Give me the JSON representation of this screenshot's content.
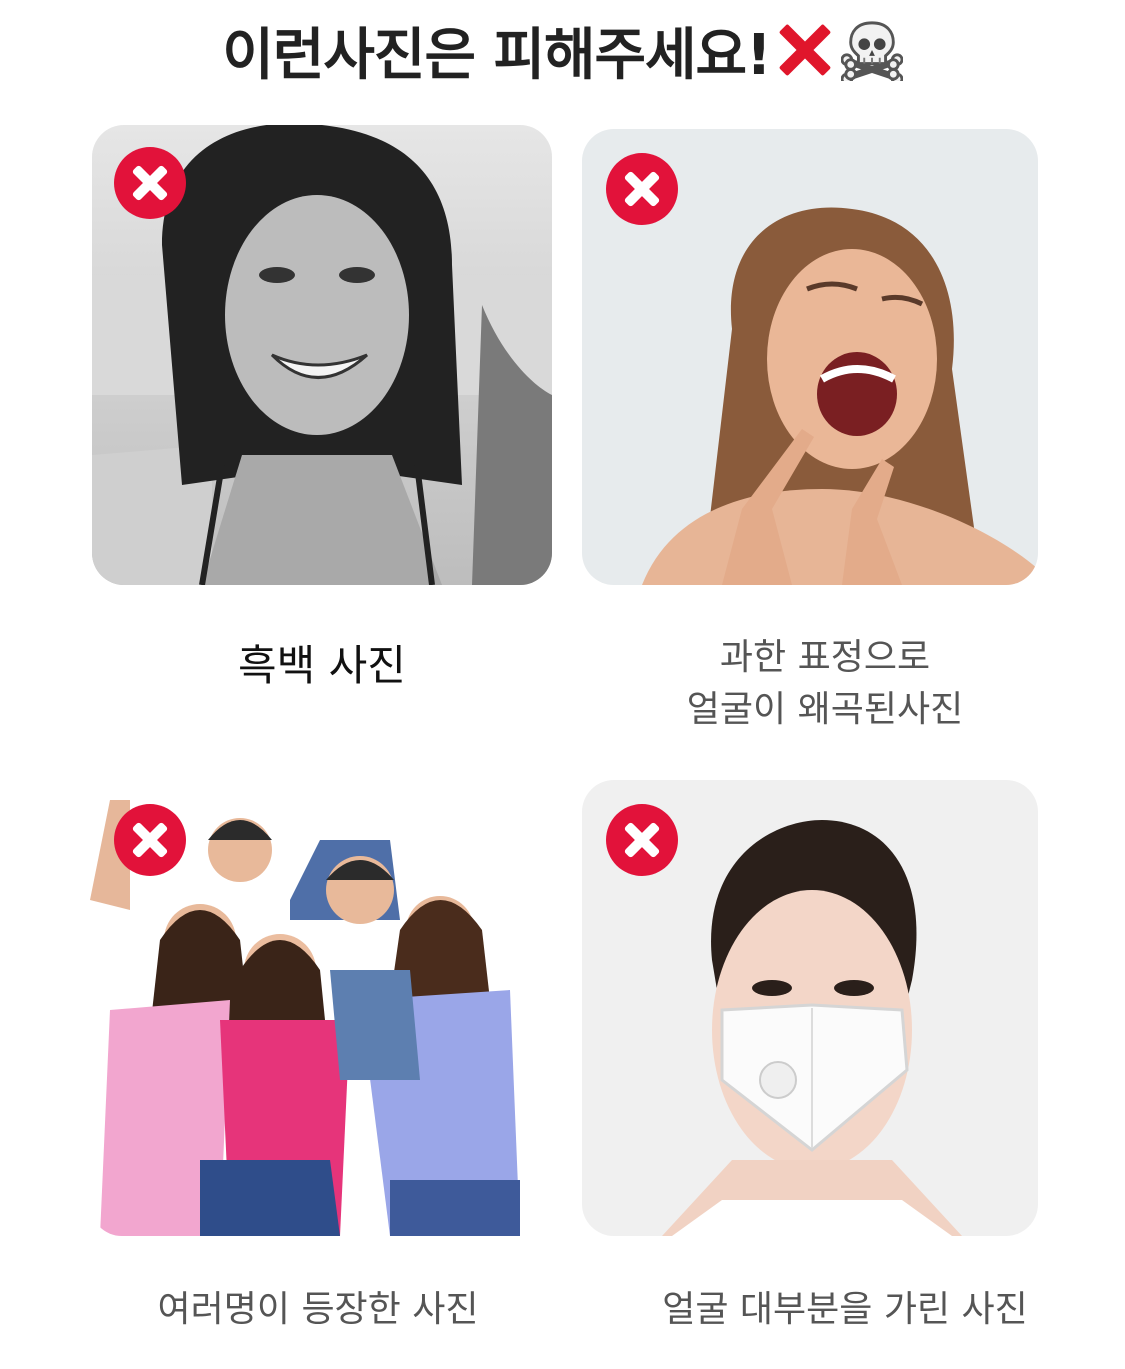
{
  "header": {
    "title": "이런사진은 피해주세요!",
    "icons": [
      "x-mark-icon",
      "skull-crossbones-icon"
    ],
    "accent_color": "#e0162b"
  },
  "examples": [
    {
      "caption_line1": "흑백 사진",
      "caption_line2": "",
      "badge_icon": "close-icon"
    },
    {
      "caption_line1": "과한 표정으로",
      "caption_line2": "얼굴이 왜곡된사진",
      "badge_icon": "close-icon"
    },
    {
      "caption_line1": "여러명이 등장한 사진",
      "caption_line2": "",
      "badge_icon": "close-icon"
    },
    {
      "caption_line1": "얼굴 대부분을 가린 사진",
      "caption_line2": "",
      "badge_icon": "close-icon"
    }
  ]
}
